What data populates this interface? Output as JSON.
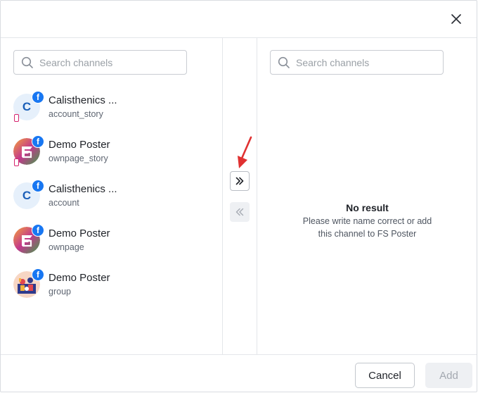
{
  "left": {
    "search": {
      "placeholder": "Search channels"
    },
    "channels": [
      {
        "name": "Calisthenics ...",
        "subtitle": "account_story",
        "avatar": "letter",
        "letter": "C",
        "network_badge": "f",
        "instagram": true
      },
      {
        "name": "Demo Poster",
        "subtitle": "ownpage_story",
        "avatar": "fs-logo",
        "network_badge": "f",
        "instagram": true
      },
      {
        "name": "Calisthenics ...",
        "subtitle": "account",
        "avatar": "letter",
        "letter": "C",
        "network_badge": "f",
        "instagram": false
      },
      {
        "name": "Demo Poster",
        "subtitle": "ownpage",
        "avatar": "fs-logo",
        "network_badge": "f",
        "instagram": false
      },
      {
        "name": "Demo Poster",
        "subtitle": "group",
        "avatar": "illustration",
        "network_badge": "f",
        "instagram": false
      }
    ]
  },
  "right": {
    "search": {
      "placeholder": "Search channels"
    },
    "empty": {
      "title": "No result",
      "line1": "Please write name correct or add",
      "line2": "this channel to FS Poster"
    }
  },
  "footer": {
    "cancel_label": "Cancel",
    "add_label": "Add"
  },
  "icons": {
    "close": "close-icon",
    "search": "search-icon",
    "move_right": "double-chevron-right-icon",
    "move_left": "double-chevron-left-icon",
    "annotation": "red-arrow-icon"
  },
  "colors": {
    "facebook": "#1877f2",
    "instagram": "#d6246e",
    "annotation": "#e03131"
  }
}
